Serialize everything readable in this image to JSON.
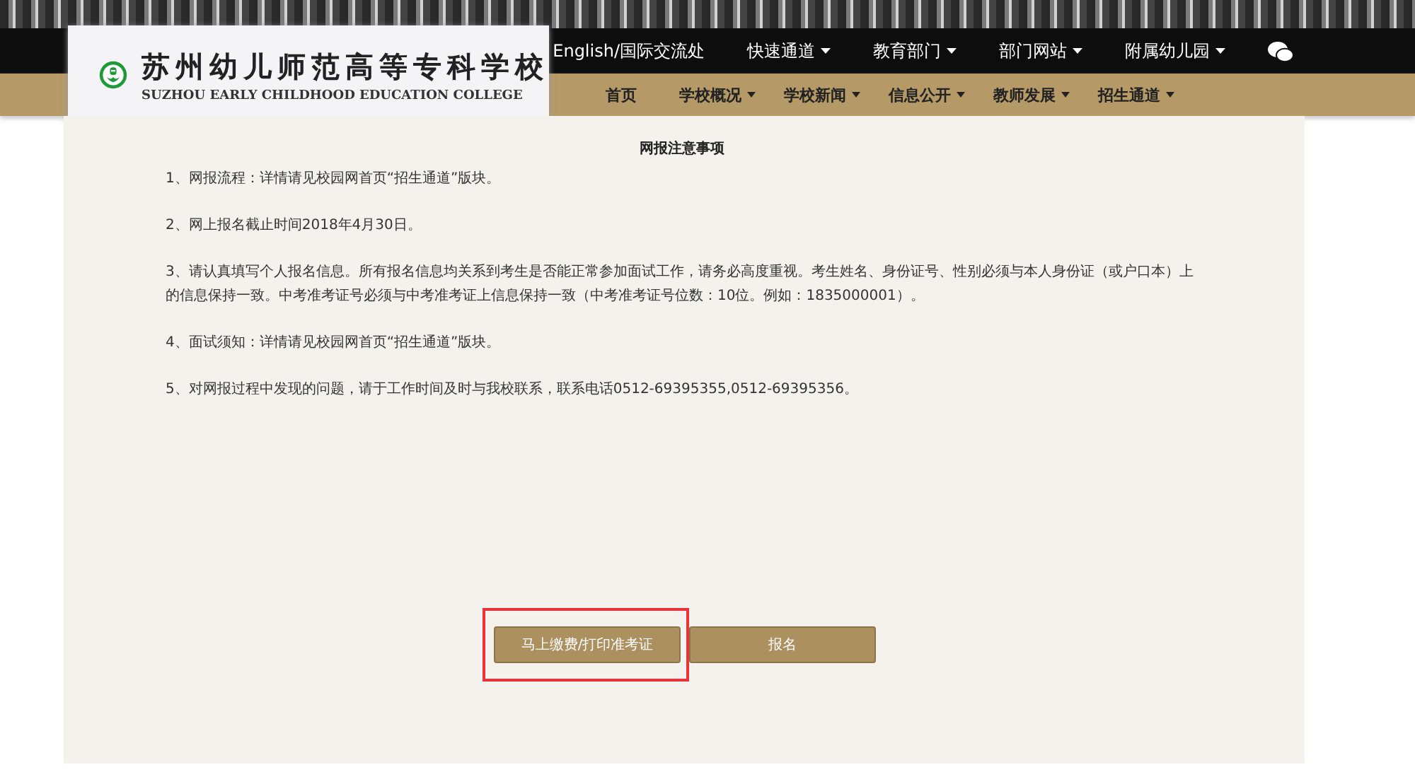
{
  "logo": {
    "name_cn": "苏州幼儿师范高等专科学校",
    "name_en": "SUZHOU EARLY CHILDHOOD EDUCATION COLLEGE"
  },
  "top_nav": [
    {
      "label": "English/国际交流处",
      "has_menu": false
    },
    {
      "label": "快速通道",
      "has_menu": true
    },
    {
      "label": "教育部门",
      "has_menu": true
    },
    {
      "label": "部门网站",
      "has_menu": true
    },
    {
      "label": "附属幼儿园",
      "has_menu": true
    }
  ],
  "main_nav": [
    {
      "label": "首页",
      "has_menu": false
    },
    {
      "label": "学校概况",
      "has_menu": true
    },
    {
      "label": "学校新闻",
      "has_menu": true
    },
    {
      "label": "信息公开",
      "has_menu": true
    },
    {
      "label": "教师发展",
      "has_menu": true
    },
    {
      "label": "招生通道",
      "has_menu": true
    }
  ],
  "notice": {
    "title": "网报注意事项",
    "items": [
      "1、网报流程：详情请见校园网首页“招生通道”版块。",
      "2、网上报名截止时间2018年4月30日。",
      "3、请认真填写个人报名信息。所有报名信息均关系到考生是否能正常参加面试工作，请务必高度重视。考生姓名、身份证号、性别必须与本人身份证（或户口本）上的信息保持一致。中考准考证号必须与中考准考证上信息保持一致（中考准考证号位数：10位。例如：1835000001）。",
      "4、面试须知：详情请见校园网首页“招生通道”版块。",
      "5、对网报过程中发现的问题，请于工作时间及时与我校联系，联系电话0512-69395355,0512-69395356。"
    ]
  },
  "buttons": [
    {
      "label": "马上缴费/打印准考证",
      "highlighted": true
    },
    {
      "label": "报名",
      "highlighted": false
    }
  ]
}
